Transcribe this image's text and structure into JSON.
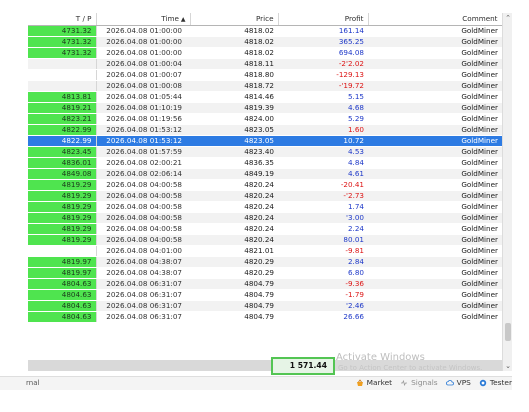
{
  "columns": {
    "tp": "T / P",
    "time": "Time",
    "price": "Price",
    "profit": "Profit",
    "comment": "Comment"
  },
  "rows": [
    {
      "tp": "4731.32",
      "time": "2026.04.08 01:00:00",
      "price": "4818.02",
      "profit": "161.14",
      "comment": "GoldMiner",
      "tp_green": true,
      "neg": false
    },
    {
      "tp": "4731.32",
      "time": "2026.04.08 01:00:00",
      "price": "4818.02",
      "profit": "365.25",
      "comment": "GoldMiner",
      "tp_green": true,
      "neg": false
    },
    {
      "tp": "4731.32",
      "time": "2026.04.08 01:00:00",
      "price": "4818.02",
      "profit": "694.08",
      "comment": "GoldMiner",
      "tp_green": true,
      "neg": false
    },
    {
      "tp": "",
      "time": "2026.04.08 01:00:04",
      "price": "4818.11",
      "profit": "-2'2.02",
      "comment": "GoldMiner",
      "tp_green": false,
      "neg": true
    },
    {
      "tp": "",
      "time": "2026.04.08 01:00:07",
      "price": "4818.80",
      "profit": "-129.13",
      "comment": "GoldMiner",
      "tp_green": false,
      "neg": true
    },
    {
      "tp": "",
      "time": "2026.04.08 01:00:08",
      "price": "4818.72",
      "profit": "-'19.72",
      "comment": "GoldMiner",
      "tp_green": false,
      "neg": true
    },
    {
      "tp": "4813.81",
      "time": "2026.04.08 01:05:44",
      "price": "4814.46",
      "profit": "5.15",
      "comment": "GoldMiner",
      "tp_green": true,
      "neg": false
    },
    {
      "tp": "4819.21",
      "time": "2026.04.08 01:10:19",
      "price": "4819.39",
      "profit": "4.68",
      "comment": "GoldMiner",
      "tp_green": true,
      "neg": false
    },
    {
      "tp": "4823.21",
      "time": "2026.04.08 01:19:56",
      "price": "4824.00",
      "profit": "5.29",
      "comment": "GoldMiner",
      "tp_green": true,
      "neg": false
    },
    {
      "tp": "4822.99",
      "time": "2026.04.08 01:53:12",
      "price": "4823.05",
      "profit": "1.60",
      "comment": "GoldMiner",
      "tp_green": true,
      "neg": true
    },
    {
      "tp": "4822.99",
      "time": "2026.04.08 01:53:12",
      "price": "4823.05",
      "profit": "10.72",
      "comment": "GoldMiner",
      "tp_green": true,
      "neg": false,
      "selected": true
    },
    {
      "tp": "4823.45",
      "time": "2026.04.08 01:57:59",
      "price": "4823.40",
      "profit": "4.53",
      "comment": "GoldMiner",
      "tp_green": true,
      "neg": false
    },
    {
      "tp": "4836.01",
      "time": "2026.04.08 02:00:21",
      "price": "4836.35",
      "profit": "4.84",
      "comment": "GoldMiner",
      "tp_green": true,
      "neg": false
    },
    {
      "tp": "4849.08",
      "time": "2026.04.08 02:06:14",
      "price": "4849.19",
      "profit": "4.61",
      "comment": "GoldMiner",
      "tp_green": true,
      "neg": false
    },
    {
      "tp": "4819.29",
      "time": "2026.04.08 04:00:58",
      "price": "4820.24",
      "profit": "-20.41",
      "comment": "GoldMiner",
      "tp_green": true,
      "neg": true
    },
    {
      "tp": "4819.29",
      "time": "2026.04.08 04:00:58",
      "price": "4820.24",
      "profit": "-'2.73",
      "comment": "GoldMiner",
      "tp_green": true,
      "neg": true
    },
    {
      "tp": "4819.29",
      "time": "2026.04.08 04:00:58",
      "price": "4820.24",
      "profit": "1.74",
      "comment": "GoldMiner",
      "tp_green": true,
      "neg": false
    },
    {
      "tp": "4819.29",
      "time": "2026.04.08 04:00:58",
      "price": "4820.24",
      "profit": "'3.00",
      "comment": "GoldMiner",
      "tp_green": true,
      "neg": false
    },
    {
      "tp": "4819.29",
      "time": "2026.04.08 04:00:58",
      "price": "4820.24",
      "profit": "2.24",
      "comment": "GoldMiner",
      "tp_green": true,
      "neg": false
    },
    {
      "tp": "4819.29",
      "time": "2026.04.08 04:00:58",
      "price": "4820.24",
      "profit": "80.01",
      "comment": "GoldMiner",
      "tp_green": true,
      "neg": false
    },
    {
      "tp": "",
      "time": "2026.04.08 04:01:00",
      "price": "4821.01",
      "profit": "-9.81",
      "comment": "GoldMiner",
      "tp_green": false,
      "neg": true
    },
    {
      "tp": "4819.97",
      "time": "2026.04.08 04:38:07",
      "price": "4820.29",
      "profit": "2.84",
      "comment": "GoldMiner",
      "tp_green": true,
      "neg": false
    },
    {
      "tp": "4819.97",
      "time": "2026.04.08 04:38:07",
      "price": "4820.29",
      "profit": "6.80",
      "comment": "GoldMiner",
      "tp_green": true,
      "neg": false
    },
    {
      "tp": "4804.63",
      "time": "2026.04.08 06:31:07",
      "price": "4804.79",
      "profit": "-9.36",
      "comment": "GoldMiner",
      "tp_green": true,
      "neg": true
    },
    {
      "tp": "4804.63",
      "time": "2026.04.08 06:31:07",
      "price": "4804.79",
      "profit": "-1.79",
      "comment": "GoldMiner",
      "tp_green": true,
      "neg": true
    },
    {
      "tp": "4804.63",
      "time": "2026.04.08 06:31:07",
      "price": "4804.79",
      "profit": "'2.46",
      "comment": "GoldMiner",
      "tp_green": true,
      "neg": false
    },
    {
      "tp": "4804.63",
      "time": "2026.04.08 06:31:07",
      "price": "4804.79",
      "profit": "26.66",
      "comment": "GoldMiner",
      "tp_green": true,
      "neg": false
    }
  ],
  "total": "1 571.44",
  "watermark": {
    "line1": "Activate Windows",
    "line2": "Go to Action Center to activate Windows."
  },
  "status": {
    "left_label": "rnal",
    "tabs": [
      {
        "label": "Market",
        "icon": "basket-icon"
      },
      {
        "label": "Signals",
        "icon": "signal-icon"
      },
      {
        "label": "VPS",
        "icon": "cloud-icon"
      },
      {
        "label": "Tester",
        "icon": "tester-icon"
      }
    ]
  },
  "colors": {
    "tp_green": "#4fe44f",
    "selected": "#2d7be3",
    "profit_pos": "#1e38c8",
    "profit_neg": "#dd1515"
  }
}
